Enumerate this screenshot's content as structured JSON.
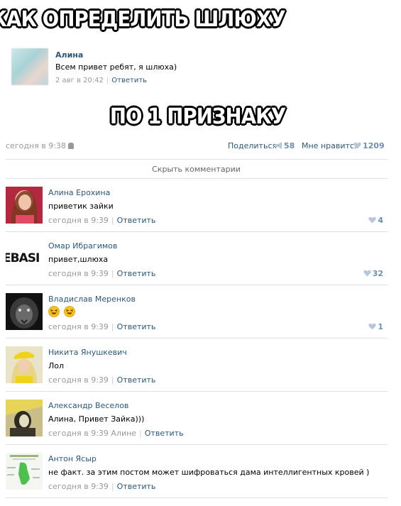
{
  "meme": {
    "top_caption": "КАК ОПРЕДЕЛИТЬ ШЛЮХУ",
    "middle_caption": "ПО 1 ПРИЗНАКУ"
  },
  "quoted_comment": {
    "author": "Алина",
    "text": "Всем привет ребят, я шлюха)",
    "date": "2 авг в 20:42",
    "reply": "Ответить"
  },
  "post": {
    "date": "сегодня в 9:38",
    "share_label": "Поделиться",
    "share_count": "58",
    "like_label": "Мне нравится",
    "like_count": "1209",
    "hide_comments": "Скрыть комментарии"
  },
  "comments": [
    {
      "author": "Алина Ерохина",
      "text": "приветик зайки",
      "date": "сегодня в 9:39",
      "reply": "Ответить",
      "likes": "4"
    },
    {
      "author": "Омар Ибрагимов",
      "text": "привет,шлюха",
      "date": "сегодня в 9:39",
      "reply": "Ответить",
      "likes": "32"
    },
    {
      "author": "Владислав Меренков",
      "text": "",
      "emoji": [
        "laughing-emoji",
        "laughing-emoji"
      ],
      "date": "сегодня в 9:39",
      "reply": "Ответить",
      "likes": "1"
    },
    {
      "author": "Никита Янушкевич",
      "text": "Лол",
      "date": "сегодня в 9:39",
      "reply": "Ответить",
      "likes": ""
    },
    {
      "author": "Александр Веселов",
      "text": "Алина, Привет Зайка)))",
      "date": "сегодня в 9:39 Алине",
      "reply": "Ответить",
      "likes": ""
    },
    {
      "author": "Антон Ясыр",
      "text": "не факт. за этим постом может шифроваться дама интеллигентных кровей )",
      "date": "сегодня в 9:39",
      "reply": "Ответить",
      "likes": ""
    }
  ],
  "avatar_label_omar": "EBASI",
  "colors": {
    "link": "#2b587a",
    "meta": "#999999",
    "divider": "#dae1e8",
    "like": "#6b8fb1"
  }
}
